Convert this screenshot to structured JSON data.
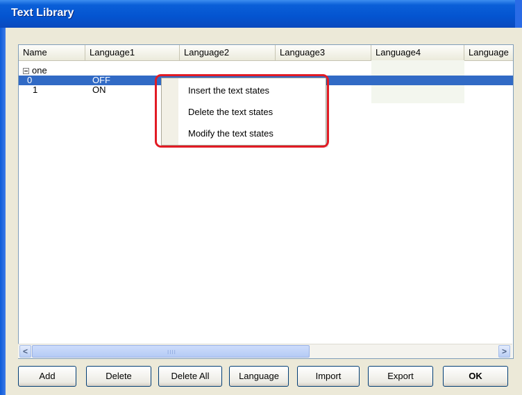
{
  "window": {
    "title": "Text Library"
  },
  "columns": [
    "Name",
    "Language1",
    "Language2",
    "Language3",
    "Language4",
    "Language"
  ],
  "tree": {
    "group": "one",
    "rows": [
      {
        "name": "0",
        "language1": "OFF",
        "selected": true
      },
      {
        "name": "1",
        "language1": "ON",
        "selected": false
      }
    ]
  },
  "context_menu": {
    "items": [
      "Insert the text states",
      "Delete the text states",
      "Modify the text states"
    ]
  },
  "buttons": {
    "add": "Add",
    "delete": "Delete",
    "delete_all": "Delete All",
    "language": "Language",
    "import": "Import",
    "export": "Export",
    "ok": "OK"
  },
  "colors": {
    "selection": "#316ac5",
    "highlight_box": "#e21b24"
  },
  "scroll": {
    "left_arrow": "<",
    "right_arrow": ">",
    "grip": "IIII"
  }
}
